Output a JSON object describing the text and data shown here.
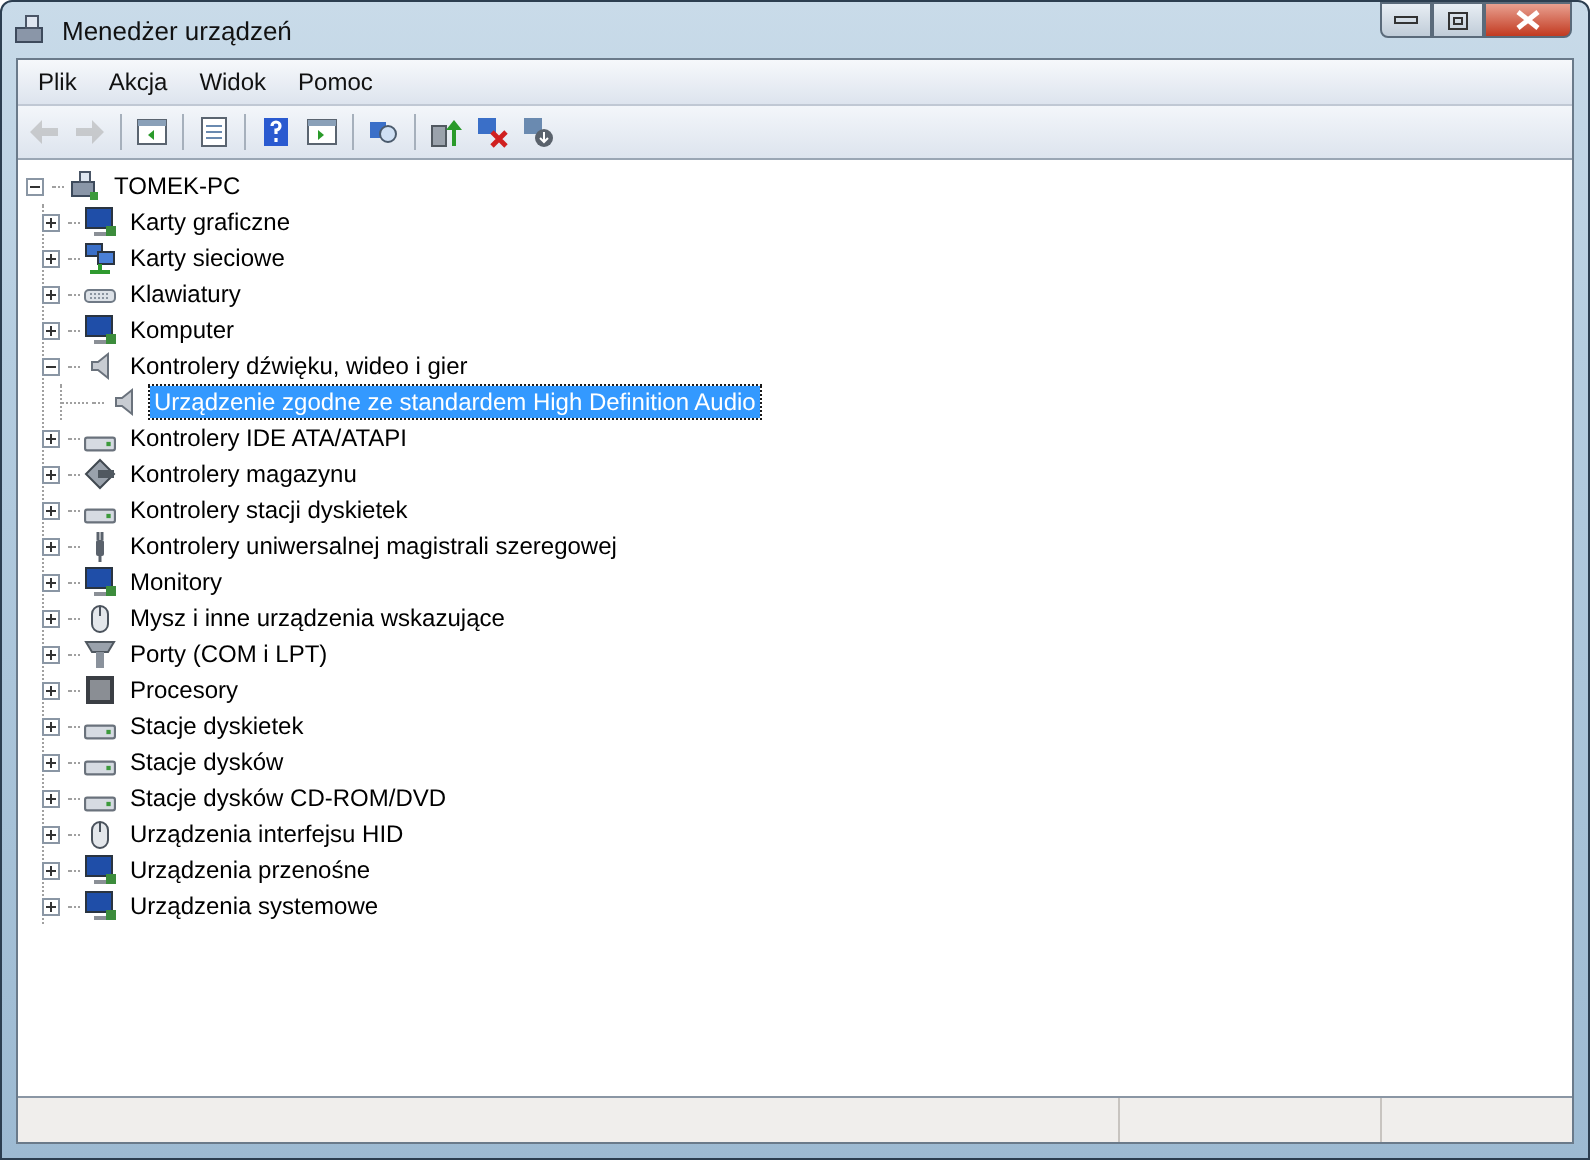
{
  "window": {
    "title": "Menedżer urządzeń"
  },
  "menu": [
    {
      "label": "Plik"
    },
    {
      "label": "Akcja"
    },
    {
      "label": "Widok"
    },
    {
      "label": "Pomoc"
    }
  ],
  "toolbar": [
    {
      "kind": "back",
      "disabled": true
    },
    {
      "kind": "forward",
      "disabled": true
    },
    {
      "kind": "sep"
    },
    {
      "kind": "tree-pane",
      "disabled": false
    },
    {
      "kind": "sep"
    },
    {
      "kind": "properties",
      "disabled": false
    },
    {
      "kind": "sep"
    },
    {
      "kind": "help",
      "disabled": false
    },
    {
      "kind": "action-pane",
      "disabled": false
    },
    {
      "kind": "sep"
    },
    {
      "kind": "scan",
      "disabled": false
    },
    {
      "kind": "sep"
    },
    {
      "kind": "update",
      "disabled": false
    },
    {
      "kind": "uninstall",
      "disabled": false
    },
    {
      "kind": "disable",
      "disabled": false
    }
  ],
  "tree": {
    "label": "TOMEK-PC",
    "kind": "computer",
    "expanded": true,
    "selected": false,
    "children": [
      {
        "label": "Karty graficzne",
        "kind": "monitor",
        "expanded": false,
        "selected": false
      },
      {
        "label": "Karty sieciowe",
        "kind": "network",
        "expanded": false,
        "selected": false
      },
      {
        "label": "Klawiatury",
        "kind": "keyboard",
        "expanded": false,
        "selected": false
      },
      {
        "label": "Komputer",
        "kind": "monitor",
        "expanded": false,
        "selected": false
      },
      {
        "label": "Kontrolery dźwięku, wideo i gier",
        "kind": "speaker",
        "expanded": true,
        "selected": false,
        "children": [
          {
            "label": "Urządzenie zgodne ze standardem High Definition Audio",
            "kind": "speaker",
            "selected": true
          }
        ]
      },
      {
        "label": "Kontrolery IDE ATA/ATAPI",
        "kind": "drive",
        "expanded": false,
        "selected": false
      },
      {
        "label": "Kontrolery magazynu",
        "kind": "diamond",
        "expanded": false,
        "selected": false
      },
      {
        "label": "Kontrolery stacji dyskietek",
        "kind": "drive",
        "expanded": false,
        "selected": false
      },
      {
        "label": "Kontrolery uniwersalnej magistrali szeregowej",
        "kind": "plug",
        "expanded": false,
        "selected": false
      },
      {
        "label": "Monitory",
        "kind": "monitor",
        "expanded": false,
        "selected": false
      },
      {
        "label": "Mysz i inne urządzenia wskazujące",
        "kind": "mouse",
        "expanded": false,
        "selected": false
      },
      {
        "label": "Porty (COM i LPT)",
        "kind": "port",
        "expanded": false,
        "selected": false
      },
      {
        "label": "Procesory",
        "kind": "chip",
        "expanded": false,
        "selected": false
      },
      {
        "label": "Stacje dyskietek",
        "kind": "drive",
        "expanded": false,
        "selected": false
      },
      {
        "label": "Stacje dysków",
        "kind": "drive",
        "expanded": false,
        "selected": false
      },
      {
        "label": "Stacje dysków CD-ROM/DVD",
        "kind": "drive",
        "expanded": false,
        "selected": false
      },
      {
        "label": "Urządzenia interfejsu HID",
        "kind": "mouse",
        "expanded": false,
        "selected": false
      },
      {
        "label": "Urządzenia przenośne",
        "kind": "monitor",
        "expanded": false,
        "selected": false
      },
      {
        "label": "Urządzenia systemowe",
        "kind": "monitor",
        "expanded": false,
        "selected": false
      }
    ]
  }
}
